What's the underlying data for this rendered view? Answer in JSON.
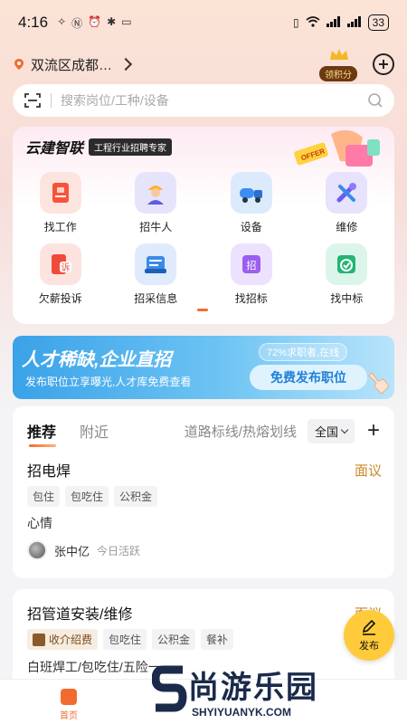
{
  "status_bar": {
    "time": "4:16",
    "battery": "33"
  },
  "location": {
    "text": "双流区成都…"
  },
  "points": {
    "label": "领积分"
  },
  "search": {
    "placeholder": "搜索岗位/工种/设备"
  },
  "brand": {
    "name": "云建智联",
    "tag": "工程行业招聘专家",
    "offer_word": "OFFER"
  },
  "services": [
    {
      "label": "找工作",
      "icon": "briefcase-icon",
      "color": "#f8533a"
    },
    {
      "label": "招牛人",
      "icon": "worker-icon",
      "color": "#ffb02e"
    },
    {
      "label": "设备",
      "icon": "truck-icon",
      "color": "#3d8ef0"
    },
    {
      "label": "维修",
      "icon": "wrench-icon",
      "color": "#6a5cf0"
    },
    {
      "label": "欠薪投诉",
      "icon": "complaint-icon",
      "color": "#f04b3a"
    },
    {
      "label": "招采信息",
      "icon": "procurement-icon",
      "color": "#3a8be8"
    },
    {
      "label": "找招标",
      "icon": "bidding-icon",
      "color": "#9a5ef0"
    },
    {
      "label": "找中标",
      "icon": "award-icon",
      "color": "#22b573"
    }
  ],
  "service_icon_text": {
    "complaint": "诉",
    "bidding": "招"
  },
  "banner": {
    "title": "人才稀缺,企业直招",
    "subtitle": "发布职位立享曝光,人才库免费查看",
    "chip": "72%求职者,在线",
    "button": "免费发布职位"
  },
  "feed": {
    "tabs": [
      "推荐",
      "附近"
    ],
    "filter": "道路标线/热熔划线",
    "region": "全国"
  },
  "jobs": [
    {
      "title": "招电焊",
      "salary": "面议",
      "tags": [
        "包住",
        "包吃住",
        "公积金"
      ],
      "desc": "心情",
      "poster": "张中亿",
      "active": "今日活跃"
    },
    {
      "title": "招管道安装/维修",
      "salary": "面议",
      "accent_tag": "收介绍费",
      "tags": [
        "包吃住",
        "公积金",
        "餐补"
      ],
      "desc": "白班焊工/包吃住/五险一"
    }
  ],
  "fab": {
    "label": "发布"
  },
  "bottom_nav": {
    "home": "首页"
  },
  "watermark": {
    "main": "尚游乐园",
    "sub": "SHYIYUANYK.COM"
  }
}
